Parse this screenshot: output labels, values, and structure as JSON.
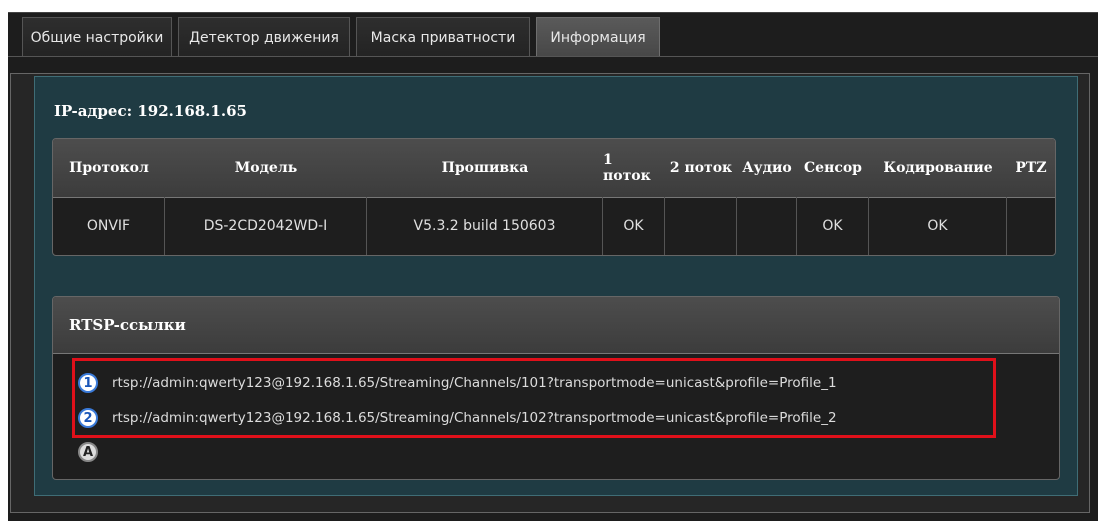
{
  "tabs": [
    {
      "label": "Общие настройки"
    },
    {
      "label": "Детектор движения"
    },
    {
      "label": "Маска приватности"
    },
    {
      "label": "Информация"
    }
  ],
  "ip_label": "IP-адрес: 192.168.1.65",
  "table": {
    "headers": [
      "Протокол",
      "Модель",
      "Прошивка",
      "1 поток",
      "2 поток",
      "Аудио",
      "Сенсор",
      "Кодирование",
      "PTZ"
    ],
    "row": [
      "ONVIF",
      "DS-2CD2042WD-I",
      "V5.3.2 build 150603",
      "OK",
      "",
      "",
      "OK",
      "OK",
      ""
    ]
  },
  "rtsp": {
    "title": "RTSP-ссылки",
    "links": [
      {
        "badge": "1",
        "url": "rtsp://admin:qwerty123@192.168.1.65/Streaming/Channels/101?transportmode=unicast&profile=Profile_1"
      },
      {
        "badge": "2",
        "url": "rtsp://admin:qwerty123@192.168.1.65/Streaming/Channels/102?transportmode=unicast&profile=Profile_2"
      },
      {
        "badge": "A",
        "url": ""
      }
    ]
  },
  "colors": {
    "panel_teal": "#1f3b43",
    "highlight_red": "#e0101a",
    "badge_blue": "#1a56b8"
  }
}
